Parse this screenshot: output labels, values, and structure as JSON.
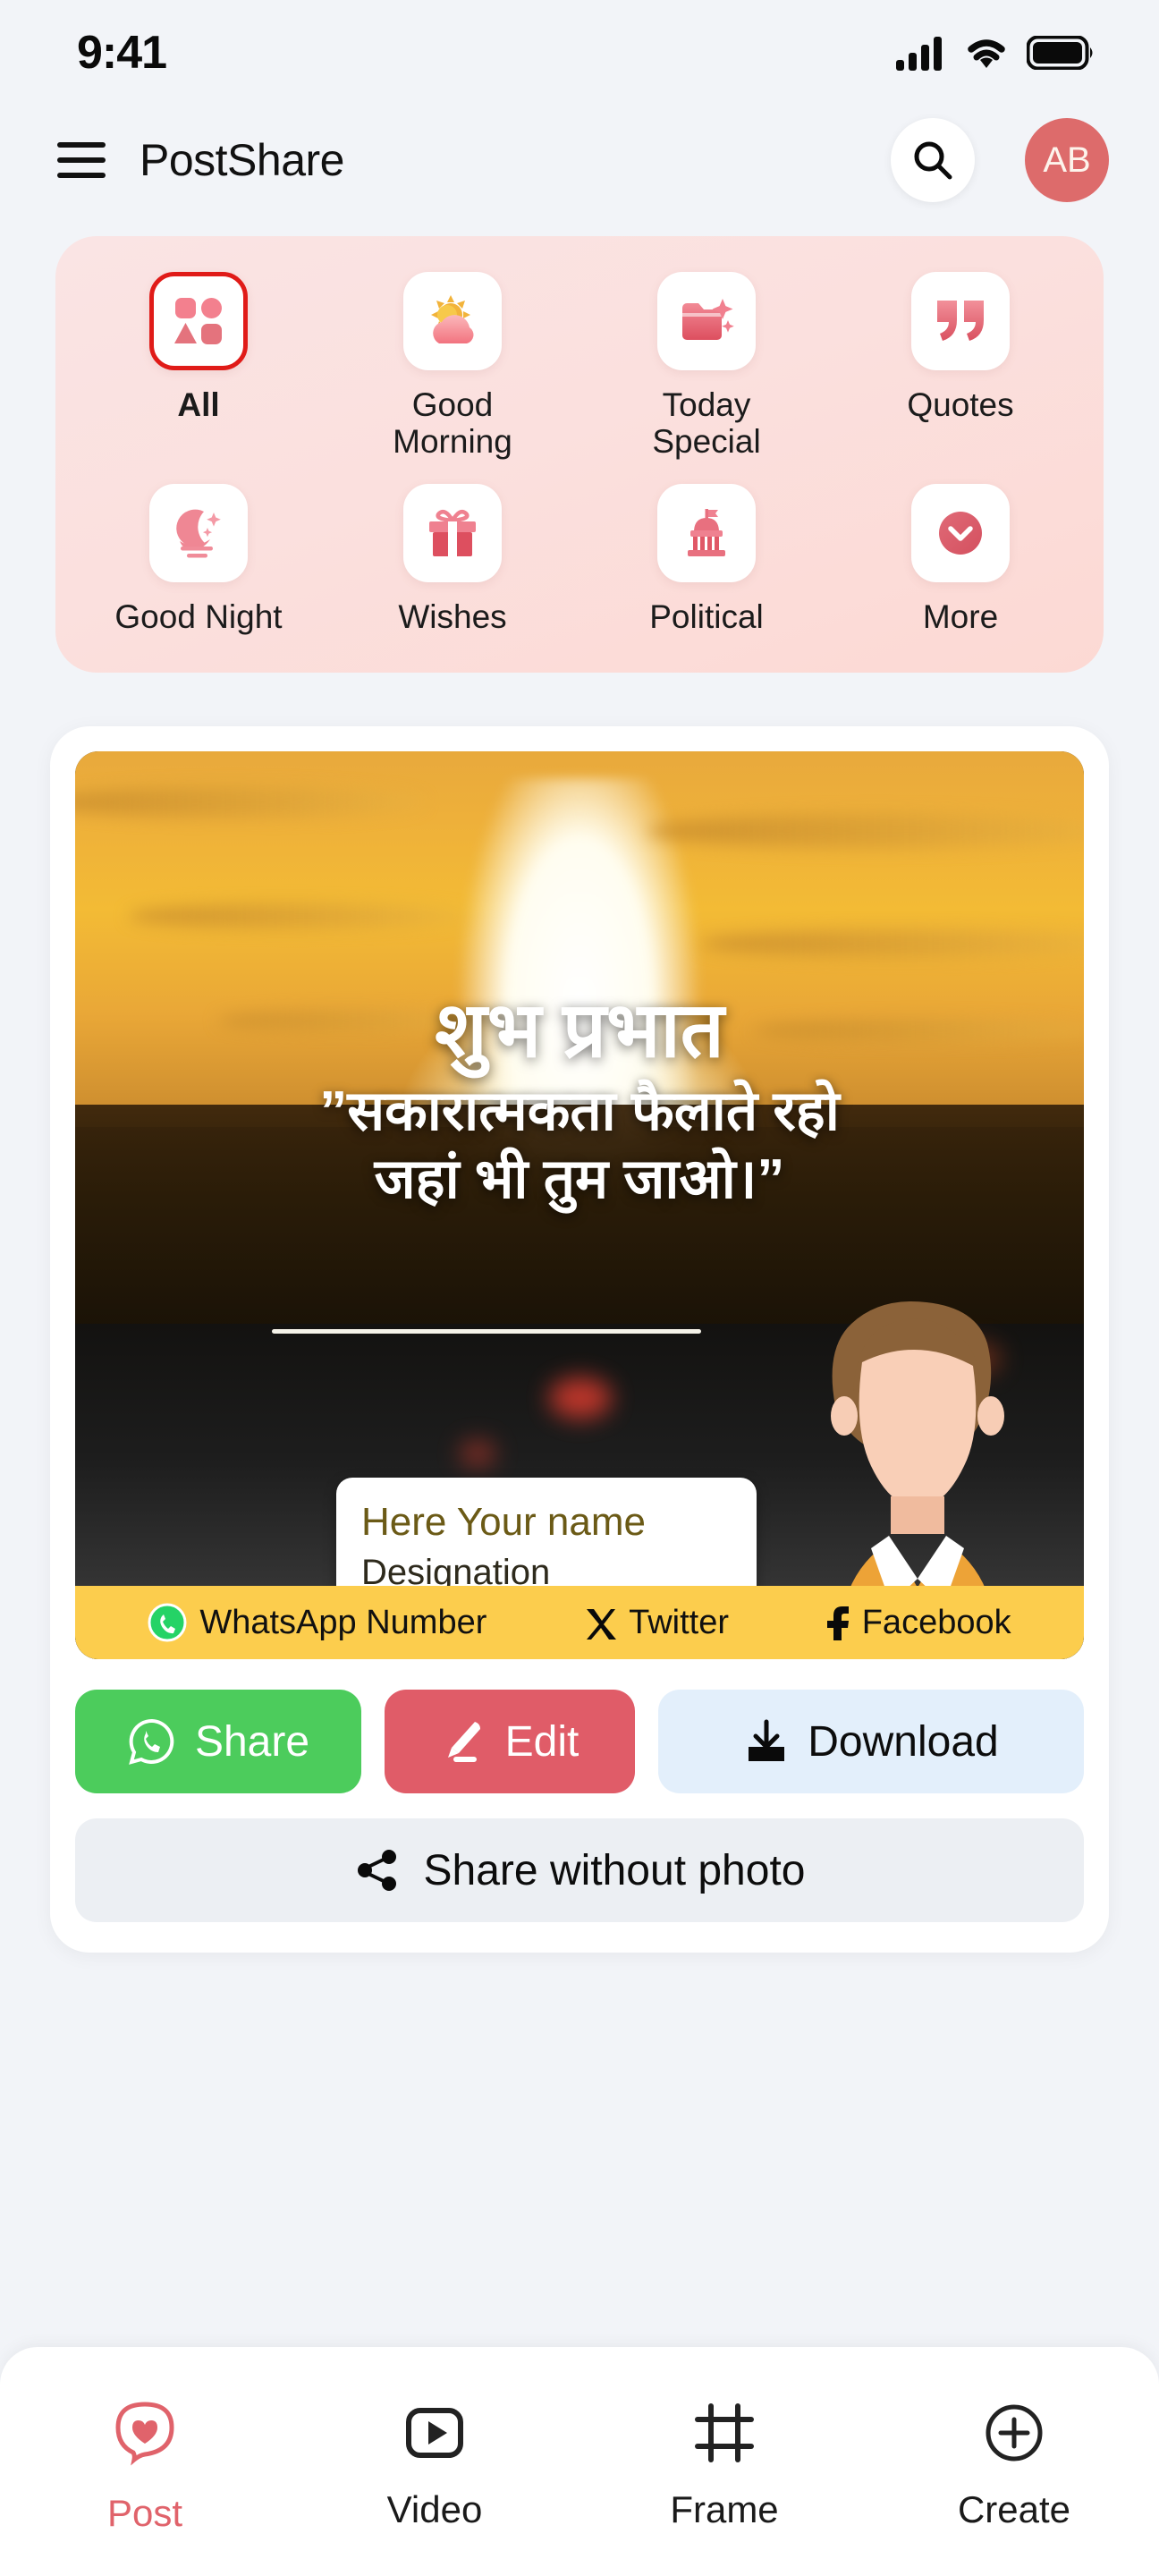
{
  "status_bar": {
    "time": "9:41",
    "icons": [
      "cellular-signal-icon",
      "wifi-icon",
      "battery-full-icon"
    ]
  },
  "header": {
    "menu_icon": "hamburger-menu-icon",
    "title": "PostShare",
    "search_icon": "search-icon",
    "avatar_initials": "AB"
  },
  "categories": {
    "items": [
      {
        "label": "All",
        "icon": "grid-shapes-icon",
        "selected": true
      },
      {
        "label": "Good Morning",
        "icon": "sun-behind-cloud-icon",
        "selected": false
      },
      {
        "label": "Today Special",
        "icon": "sparkle-folder-icon",
        "selected": false
      },
      {
        "label": "Quotes",
        "icon": "quotation-marks-icon",
        "selected": false
      },
      {
        "label": "Good Night",
        "icon": "crescent-moon-stars-icon",
        "selected": false
      },
      {
        "label": "Wishes",
        "icon": "gift-box-icon",
        "selected": false
      },
      {
        "label": "Political",
        "icon": "capitol-building-icon",
        "selected": false
      },
      {
        "label": "More",
        "icon": "chevron-down-circle-icon",
        "selected": false
      }
    ]
  },
  "post": {
    "title": "शुभ प्रभात",
    "quote_line1": "”सकारात्मकता फैलाते रहो",
    "quote_line2": "जहां भी तुम जाओ।”",
    "name_placeholder": "Here Your name",
    "designation_placeholder": "Designation",
    "social": [
      {
        "label": "WhatsApp Number",
        "icon": "whatsapp-icon"
      },
      {
        "label": "Twitter",
        "icon": "x-twitter-icon"
      },
      {
        "label": "Facebook",
        "icon": "facebook-icon"
      }
    ]
  },
  "actions": {
    "share": {
      "label": "Share",
      "icon": "whatsapp-icon",
      "color": "#4ccc5c"
    },
    "edit": {
      "label": "Edit",
      "icon": "pencil-icon",
      "color": "#e05c68"
    },
    "download": {
      "label": "Download",
      "icon": "download-icon",
      "color": "#e3effb"
    },
    "share_without_photo": {
      "label": "Share without photo",
      "icon": "share-nodes-icon"
    }
  },
  "bottom_nav": {
    "items": [
      {
        "label": "Post",
        "icon": "heart-bubble-icon",
        "active": true
      },
      {
        "label": "Video",
        "icon": "play-square-icon",
        "active": false
      },
      {
        "label": "Frame",
        "icon": "crop-frame-icon",
        "active": false
      },
      {
        "label": "Create",
        "icon": "plus-circle-icon",
        "active": false
      }
    ]
  },
  "theme": {
    "accent": "#e0636b",
    "panel_pink": "#fae4e4",
    "selected_border": "#e01b18",
    "social_bar": "#fccd4d",
    "page_bg": "#f2f4f8"
  }
}
